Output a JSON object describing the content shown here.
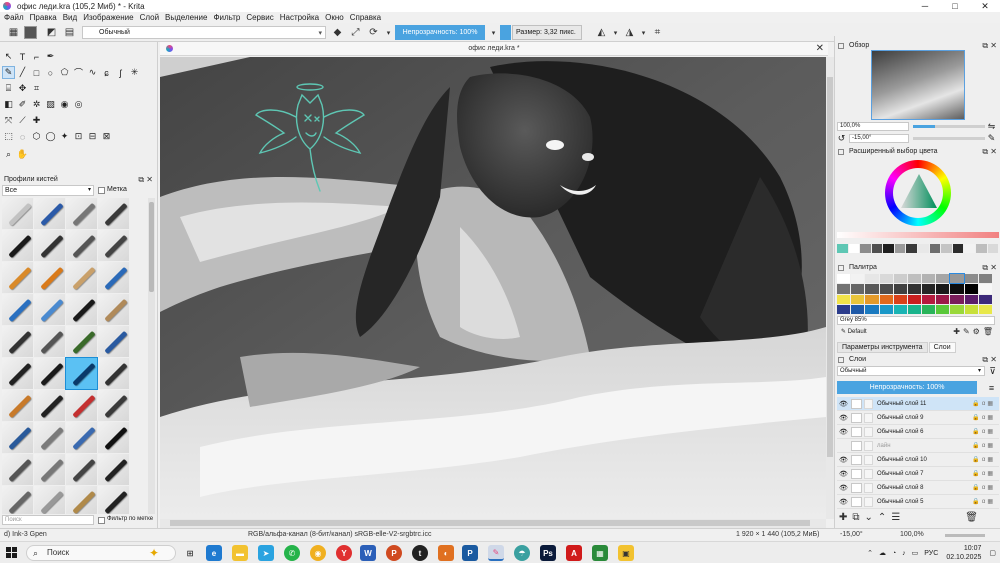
{
  "window": {
    "title": "офис леди.kra (105,2 Миб)  * - Krita",
    "controls": [
      "─",
      "□",
      "✕"
    ]
  },
  "menu": [
    "Файл",
    "Правка",
    "Вид",
    "Изображение",
    "Слой",
    "Выделение",
    "Фильтр",
    "Сервис",
    "Настройка",
    "Окно",
    "Справка"
  ],
  "toolbar": {
    "brush_preset": "Обычный",
    "opacity_label": "Непрозрачность: 100%",
    "size_label": "Размер: 3,32 пикс."
  },
  "brush_panel": {
    "title": "Профили кистей",
    "filter": "Все",
    "tag_label": "Метка",
    "search_placeholder": "Поиск",
    "filter_by_tag": "Фильтр по метке"
  },
  "canvas": {
    "tab_title": "офис леди.kra *"
  },
  "overview": {
    "title": "Обзор",
    "zoom": "100,0%",
    "rotation": "-15,00°"
  },
  "color_selector": {
    "title": "Расширенный выбор цвета",
    "history": [
      "#5ec7b4",
      "#ffffff",
      "#8c8c8c",
      "#505050",
      "#1f1f1f",
      "#9a9a9a",
      "#3a3a3a",
      "#e8e8e8",
      "#6e6e6e",
      "#c4c4c4",
      "#2b2b2b",
      "#f2f2f2",
      "#bdbdbd",
      "#d9d9d9"
    ]
  },
  "palette": {
    "title": "Палитра",
    "current_color": "Grey 85%",
    "set_name": "Default",
    "rows": [
      [
        "#ffffff",
        "#f2f2f2",
        "#e6e6e6",
        "#d9d9d9",
        "#cccccc",
        "#bfbfbf",
        "#b3b3b3",
        "#a6a6a6",
        "#999999",
        "#8c8c8c",
        "#808080"
      ],
      [
        "#737373",
        "#666666",
        "#595959",
        "#4d4d4d",
        "#404040",
        "#333333",
        "#262626",
        "#1a1a1a",
        "#0d0d0d",
        "#000000",
        "#f7f7f7"
      ],
      [
        "#f1e34a",
        "#e9c53a",
        "#e49a2a",
        "#e06a1d",
        "#d9411a",
        "#c91f1f",
        "#b51a3d",
        "#9c1948",
        "#7a1d5a",
        "#5a1d6a",
        "#3d2a7a"
      ],
      [
        "#2b3c8c",
        "#1f5aa8",
        "#1a7ac0",
        "#1a98c8",
        "#1ab4b4",
        "#1ab48c",
        "#2ab45a",
        "#5ac83a",
        "#9ad83a",
        "#c8e03a",
        "#e8e84a"
      ]
    ]
  },
  "tabs": [
    "Параметры инструмента",
    "Слои"
  ],
  "layers": {
    "title": "Слои",
    "blend_mode": "Обычный",
    "opacity_label": "Непрозрачность:  100%",
    "items": [
      {
        "name": "Обычный слой 11",
        "visible": true,
        "active": true
      },
      {
        "name": "Обычный слой 9",
        "visible": true,
        "active": false
      },
      {
        "name": "Обычный слой 6",
        "visible": true,
        "active": false
      },
      {
        "name": "лайн",
        "visible": false,
        "active": false
      },
      {
        "name": "Обычный слой 10",
        "visible": true,
        "active": false
      },
      {
        "name": "Обычный слой 7",
        "visible": true,
        "active": false
      },
      {
        "name": "Обычный слой 8",
        "visible": true,
        "active": false
      },
      {
        "name": "Обычный слой 5",
        "visible": true,
        "active": false
      }
    ]
  },
  "status": {
    "brush": "d) Ink-3 Gpen",
    "color_space": "RGB/альфа-канал (8-бит/канал)  sRGB-elle-V2-srgbtrc.icc",
    "dimensions": "1 920 × 1 440 (105,2 МиБ)",
    "rotation": "-15,00°",
    "zoom": "100,0%"
  },
  "taskbar": {
    "search": "Поиск",
    "language": "РУС",
    "time": "10:07",
    "date": "02.10.2025"
  }
}
